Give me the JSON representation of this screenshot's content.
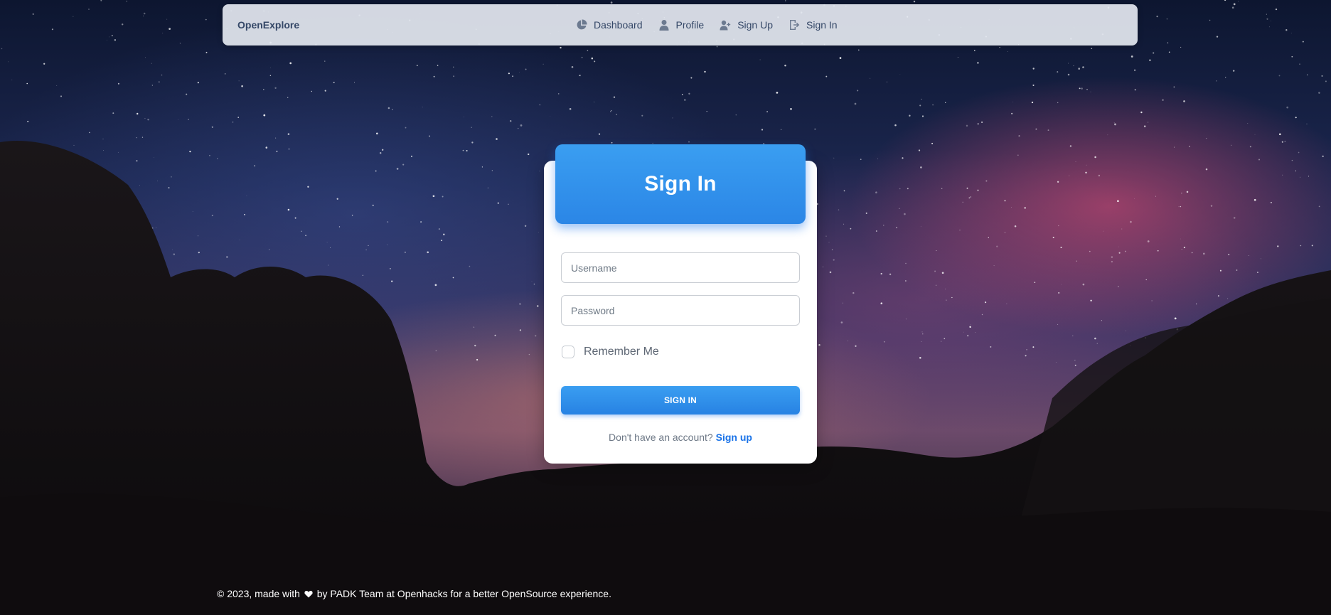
{
  "navbar": {
    "brand": "OpenExplore",
    "links": [
      {
        "label": "Dashboard",
        "icon": "pie-chart-icon"
      },
      {
        "label": "Profile",
        "icon": "person-icon"
      },
      {
        "label": "Sign Up",
        "icon": "person-add-icon"
      },
      {
        "label": "Sign In",
        "icon": "login-icon"
      }
    ]
  },
  "card": {
    "title": "Sign In",
    "username_placeholder": "Username",
    "password_placeholder": "Password",
    "remember_label": "Remember Me",
    "remember_checked": false,
    "submit_label": "SIGN IN",
    "no_account_text": "Don't have an account?",
    "signup_link": "Sign up"
  },
  "footer": {
    "prefix": "© 2023, made with",
    "suffix": "by PADK Team at Openhacks for a better OpenSource experience."
  },
  "colors": {
    "primary": "#1a73e8",
    "navbar_bg": "#e4e8f0",
    "text_dark": "#344767"
  }
}
